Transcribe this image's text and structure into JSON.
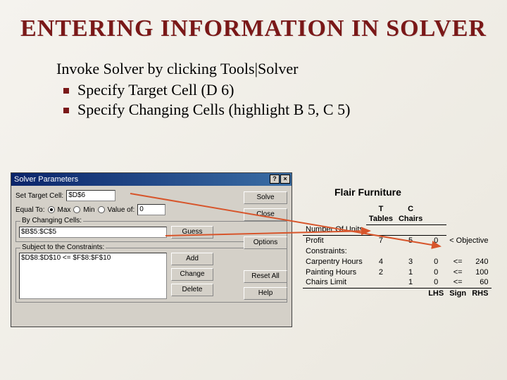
{
  "title": "ENTERING INFORMATION IN SOLVER",
  "intro": "Invoke Solver by clicking Tools|Solver",
  "bullets": [
    "Specify Target Cell (D 6)",
    "Specify Changing Cells (highlight B 5, C 5)"
  ],
  "solver": {
    "title": "Solver Parameters",
    "help_btn": "?",
    "close_btn": "×",
    "set_target_label": "Set Target Cell:",
    "target_value": "$D$6",
    "equal_to_label": "Equal To:",
    "opt_max": "Max",
    "opt_min": "Min",
    "opt_valueof": "Value of:",
    "valueof_value": "0",
    "changing_group": "By Changing Cells:",
    "changing_value": "$B$5:$C$5",
    "constraints_group": "Subject to the Constraints:",
    "constraint_text": "$D$8:$D$10 <= $F$8:$F$10",
    "btn_solve": "Solve",
    "btn_close": "Close",
    "btn_options": "Options",
    "btn_guess": "Guess",
    "btn_add": "Add",
    "btn_change": "Change",
    "btn_delete": "Delete",
    "btn_reset": "Reset All",
    "btn_help": "Help"
  },
  "sheet": {
    "title": "Flair Furniture",
    "col_T": "T",
    "col_C": "C",
    "hdr_tables": "Tables",
    "hdr_chairs": "Chairs",
    "row_units": "Number Of Units",
    "row_profit": "Profit",
    "profit_T": "7",
    "profit_C": "5",
    "profit_D": "0",
    "obj_note": "< Objective",
    "row_constraints": "Constraints:",
    "row_carpentry": "Carpentry Hours",
    "carp_T": "4",
    "carp_C": "3",
    "carp_D": "0",
    "carp_sign": "<=",
    "carp_rhs": "240",
    "row_painting": "Painting Hours",
    "paint_T": "2",
    "paint_C": "1",
    "paint_D": "0",
    "paint_sign": "<=",
    "paint_rhs": "100",
    "row_chairs": "Chairs Limit",
    "chlim_T": "",
    "chlim_C": "1",
    "chlim_D": "0",
    "chlim_sign": "<=",
    "chlim_rhs": "60",
    "ftr_lhs": "LHS",
    "ftr_sign": "Sign",
    "ftr_rhs": "RHS"
  }
}
